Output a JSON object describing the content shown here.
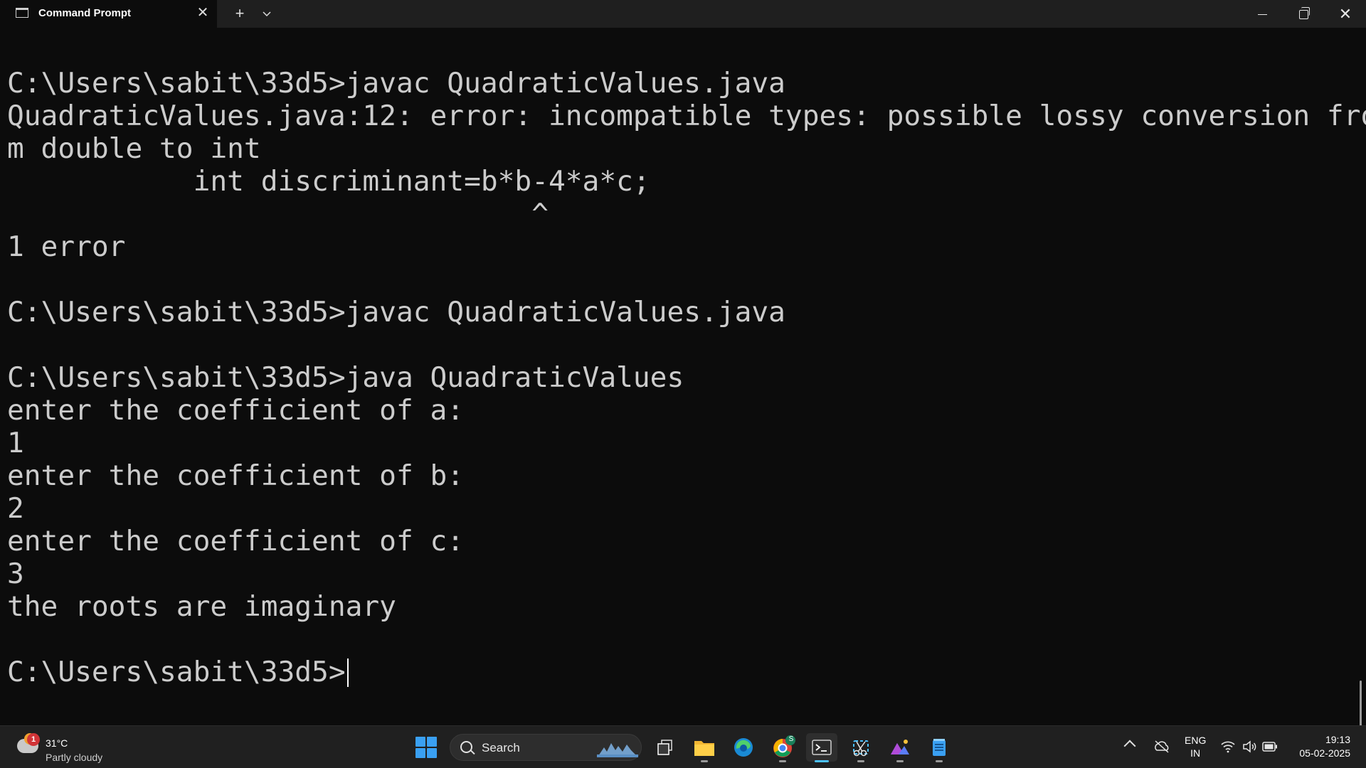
{
  "window": {
    "tab_title": "Command Prompt",
    "tab_close_glyph": "✕",
    "new_tab_glyph": "+",
    "dropdown_glyph": "⌄",
    "close_glyph": "✕"
  },
  "terminal": {
    "lines": [
      "C:\\Users\\sabit\\33d5>javac QuadraticValues.java",
      "QuadraticValues.java:12: error: incompatible types: possible lossy conversion fro",
      "m double to int",
      "           int discriminant=b*b-4*a*c;",
      "                               ^",
      "1 error",
      "",
      "C:\\Users\\sabit\\33d5>javac QuadraticValues.java",
      "",
      "C:\\Users\\sabit\\33d5>java QuadraticValues",
      "enter the coefficient of a:",
      "1",
      "enter the coefficient of b:",
      "2",
      "enter the coefficient of c:",
      "3",
      "the roots are imaginary",
      "",
      "C:\\Users\\sabit\\33d5>"
    ],
    "text_color": "#cccccc",
    "background": "#0c0c0c"
  },
  "taskbar": {
    "weather": {
      "badge": "1",
      "temp": "31°C",
      "condition": "Partly cloudy"
    },
    "search_placeholder": "Search",
    "apps": [
      {
        "name": "task-view",
        "icon": "task-view-icon"
      },
      {
        "name": "file-explorer",
        "icon": "folder-icon"
      },
      {
        "name": "edge",
        "icon": "edge-icon"
      },
      {
        "name": "chrome",
        "icon": "chrome-icon"
      },
      {
        "name": "terminal",
        "icon": "terminal-icon"
      },
      {
        "name": "snipping-tool",
        "icon": "snipping-tool-icon"
      },
      {
        "name": "photos",
        "icon": "photos-icon"
      },
      {
        "name": "notepad",
        "icon": "notepad-icon"
      }
    ],
    "chrome_badge": "S",
    "language": {
      "line1": "ENG",
      "line2": "IN"
    },
    "time": "19:13",
    "date": "05-02-2025",
    "accent": "#4cc2ff"
  }
}
